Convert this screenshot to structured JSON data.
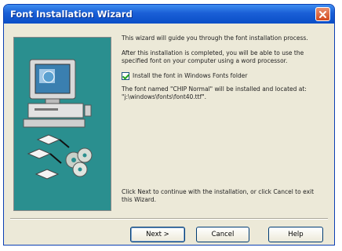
{
  "window": {
    "title": "Font Installation Wizard"
  },
  "content": {
    "intro": "This wizard will guide you through the font installation process.",
    "after_install": "After this installation is completed, you will be able to use the specified font on your computer using a word processor.",
    "checkbox_label": "Install the font in Windows Fonts folder",
    "checkbox_checked": true,
    "font_location": "The font named \"CHIP Normal\" will be installed and located at: \"j:\\windows\\fonts\\font40.ttf\".",
    "instructions": "Click Next to continue with the installation, or click Cancel to exit this Wizard."
  },
  "buttons": {
    "next": "Next >",
    "cancel": "Cancel",
    "help": "Help"
  },
  "colors": {
    "titlebar": "#0a4ec7",
    "side_panel": "#2a8f8f",
    "dialog_bg": "#ece9d8"
  }
}
